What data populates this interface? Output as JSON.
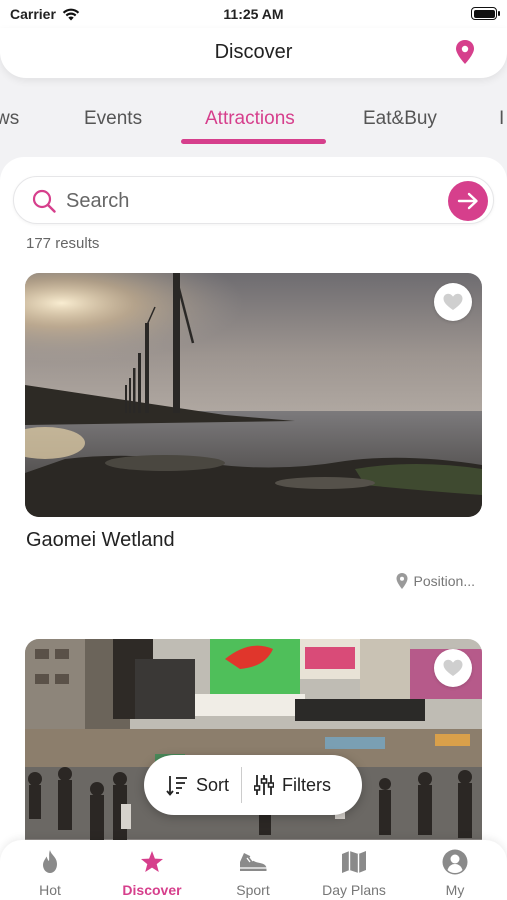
{
  "status_bar": {
    "carrier": "Carrier",
    "time": "11:25 AM"
  },
  "header": {
    "title": "Discover",
    "location_icon": "map-pin-icon"
  },
  "tabs": [
    {
      "label": "ws",
      "active": false
    },
    {
      "label": "Events",
      "active": false
    },
    {
      "label": "Attractions",
      "active": true
    },
    {
      "label": "Eat&Buy",
      "active": false
    },
    {
      "label": "I",
      "active": false
    }
  ],
  "search": {
    "placeholder": "Search",
    "value": ""
  },
  "results_count": "177 results",
  "cards": [
    {
      "title": "Gaomei Wetland",
      "position": "Position...",
      "favorite": false
    },
    {
      "title": "",
      "position": "",
      "favorite": false
    }
  ],
  "sort_bar": {
    "sort_label": "Sort",
    "filters_label": "Filters"
  },
  "bottom_nav": [
    {
      "label": "Hot",
      "icon": "flame-icon",
      "active": false
    },
    {
      "label": "Discover",
      "icon": "star-icon",
      "active": true
    },
    {
      "label": "Sport",
      "icon": "sneaker-icon",
      "active": false
    },
    {
      "label": "Day Plans",
      "icon": "map-icon",
      "active": false
    },
    {
      "label": "My",
      "icon": "user-icon",
      "active": false
    }
  ],
  "colors": {
    "accent": "#d63f8c",
    "text": "#222222",
    "muted": "#777777"
  }
}
